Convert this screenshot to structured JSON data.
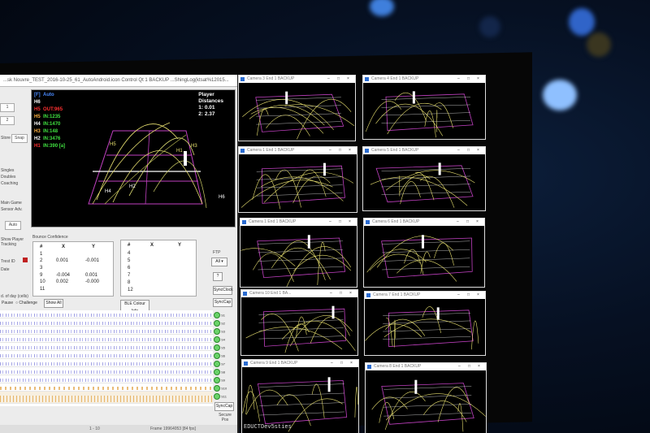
{
  "main_window": {
    "title": "...sk Nouvre_TEST_2016-10-25_61_AutoAndroid.icon Control Qt 1 BACKUP ...ShingLog(ktsat%12015...",
    "left_labels": [
      "1",
      "2",
      "Store",
      "Singles",
      "Doubles",
      "Coaching",
      "Main Game",
      "Sensor Adv.",
      "Show Player Tracking",
      "Trest ID",
      "Date",
      "d. of day (cells)",
      "Pause"
    ],
    "left_buttons": [
      "Snap",
      "Auto"
    ],
    "legend": [
      {
        "label": "[F]",
        "value": "Auto",
        "color": "#4a8bff"
      },
      {
        "label": "H6",
        "value": "",
        "color": "#ffffff"
      },
      {
        "label": "H5",
        "value": "OUT:965",
        "color": "#ff3030"
      },
      {
        "label": "H5",
        "value": "IN:1235",
        "color": "#ffb040"
      },
      {
        "label": "H4",
        "value": "IN:1470",
        "color": "#40e040"
      },
      {
        "label": "H3",
        "value": "IN:148",
        "color": "#40e040"
      },
      {
        "label": "H2",
        "value": "IN:3476",
        "color": "#40e040"
      },
      {
        "label": "H1",
        "value": "IN:390 [a]",
        "color": "#40e040"
      }
    ],
    "player_distances": {
      "title_line1": "Player",
      "title_line2": "Distances",
      "p1": "1:  0.01",
      "p2": "2:  2.37"
    },
    "court_labels": [
      "H5",
      "H3",
      "H1",
      "H4",
      "H2",
      "H6"
    ],
    "bounce_confidence_label": "Bounce Confidence",
    "table_left": {
      "headers": [
        "#",
        "X",
        "Y"
      ],
      "rows": [
        [
          "1",
          "",
          ""
        ],
        [
          "2",
          "0.001",
          "-0.001"
        ],
        [
          "3",
          "",
          ""
        ],
        [
          "9",
          "-0.004",
          "0.001"
        ],
        [
          "10",
          "0.002",
          "-0.000"
        ],
        [
          "11",
          "",
          ""
        ]
      ]
    },
    "table_right": {
      "headers": [
        "#",
        "X",
        "Y"
      ],
      "rows": [
        "4",
        "5",
        "6",
        "7",
        "8",
        "12"
      ]
    },
    "ftp_label": "FTP",
    "ftp_value": "All",
    "right_buttons": [
      "?",
      "SyncClock",
      "SyncCap",
      "SyncCap"
    ],
    "pause_label": "Pause",
    "challenge_label": "Challenge",
    "show_all_label": "Show All",
    "colour_info_label": "BLE Colour Info",
    "channels": [
      "S1",
      "S2",
      "S3",
      "S4",
      "S5",
      "S6",
      "S7",
      "S8",
      "S9",
      "S10",
      "S11",
      "S12"
    ],
    "status": {
      "left": "1 - 10",
      "right": "Frame 19964053 [84 fps]"
    },
    "secure_pos": "Secure Pos"
  },
  "cameras": [
    {
      "title": "Camera 3 End 1 BACKUP"
    },
    {
      "title": "Camera 4 End 1 BACKUP"
    },
    {
      "title": "Camera 1 End 1 BACKUP"
    },
    {
      "title": "Camera 5 End 1 BACKUP"
    },
    {
      "title": "Camera 1 End 1 BACKUP"
    },
    {
      "title": "Camera 6 End 1 BACKUP"
    },
    {
      "title": "Camera 10 End 1 BA..."
    },
    {
      "title": "Camera 7 End 1 BACKUP"
    },
    {
      "title": "Camera 9 End 1 BACKUP"
    },
    {
      "title": "Camera 8 End 1 BACKUP"
    }
  ],
  "bottom_text": "EDUCTDev5sties",
  "window_buttons": {
    "min": "–",
    "max": "□",
    "close": "×"
  },
  "colors": {
    "court_magenta": "#c040c0",
    "trajectory_yellow": "#e8e070",
    "grid_white": "#ffffff",
    "accent_blue": "#4a8bff"
  }
}
